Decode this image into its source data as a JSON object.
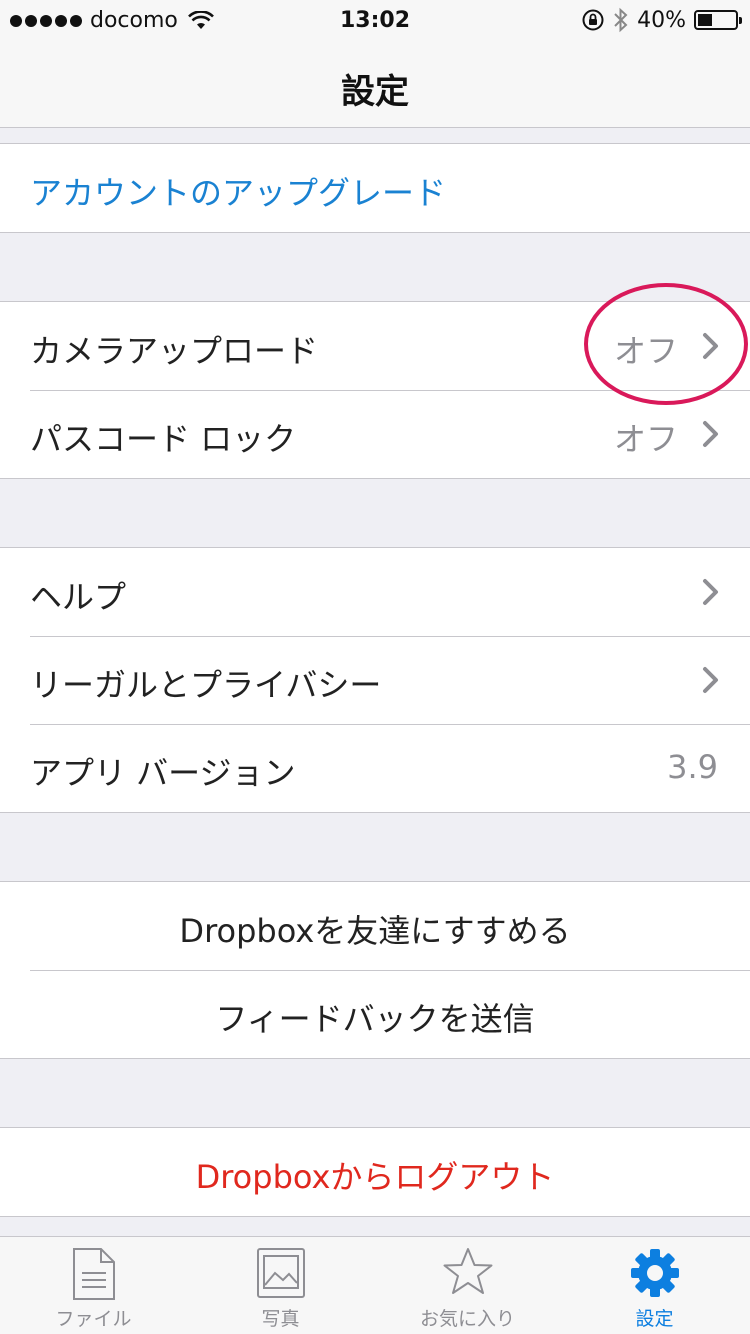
{
  "status_bar": {
    "carrier": "docomo",
    "time": "13:02",
    "battery_percent_label": "40%",
    "battery_level": 0.4
  },
  "nav": {
    "title": "設定"
  },
  "sections": {
    "upgrade": {
      "label": "アカウントのアップグレード"
    },
    "camera_upload": {
      "label": "カメラアップロード",
      "value": "オフ"
    },
    "passcode_lock": {
      "label": "パスコード ロック",
      "value": "オフ"
    },
    "help": {
      "label": "ヘルプ"
    },
    "legal": {
      "label": "リーガルとプライバシー"
    },
    "app_version": {
      "label": "アプリ バージョン",
      "value": "3.9"
    },
    "recommend": {
      "label": "Dropboxを友達にすすめる"
    },
    "feedback": {
      "label": "フィードバックを送信"
    },
    "logout": {
      "label": "Dropboxからログアウト"
    }
  },
  "tabs": [
    {
      "label": "ファイル",
      "icon": "file-icon",
      "active": false
    },
    {
      "label": "写真",
      "icon": "photo-icon",
      "active": false
    },
    {
      "label": "お気に入り",
      "icon": "star-icon",
      "active": false
    },
    {
      "label": "設定",
      "icon": "gear-icon",
      "active": true
    }
  ],
  "colors": {
    "link_blue": "#1a82d2",
    "logout_red": "#e0281e",
    "active_tab": "#0d7fe0",
    "annotation": "#d9195a"
  }
}
